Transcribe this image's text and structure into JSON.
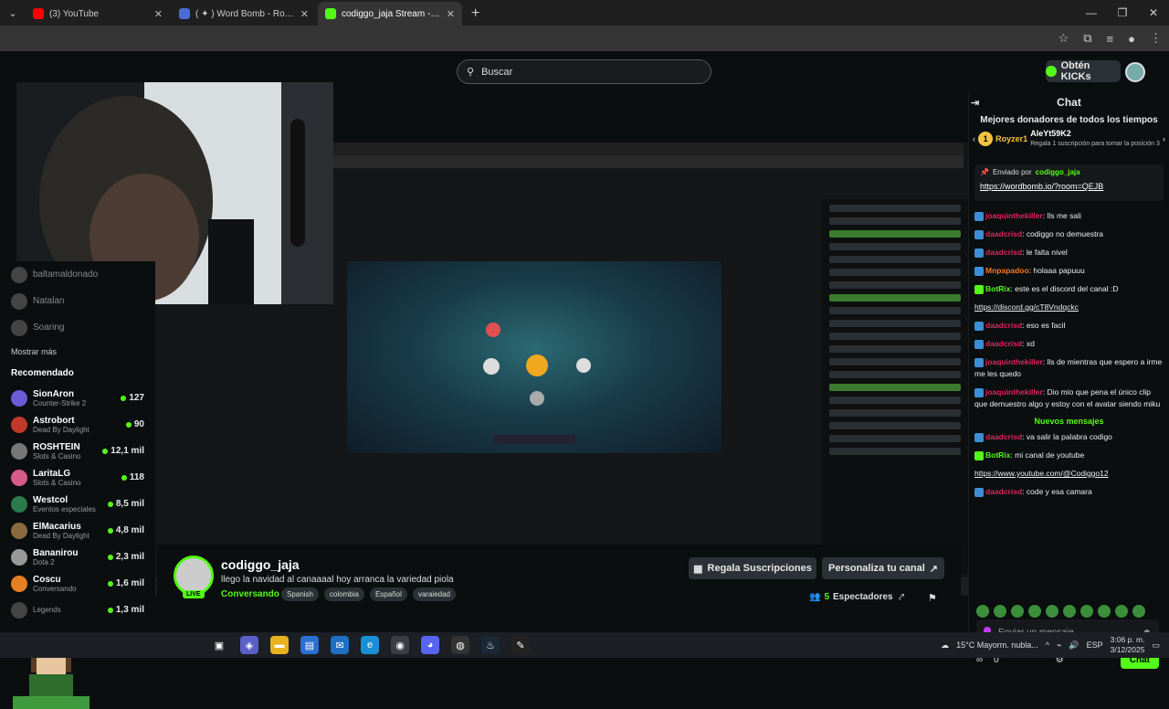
{
  "browser": {
    "tabs": [
      {
        "label": "(3) YouTube",
        "icon": "youtube-icon",
        "color": "#ff0000"
      },
      {
        "label": "( ✦ ) Word Bomb - Roblox",
        "icon": "roblox-icon",
        "color": "#4a6cd4"
      },
      {
        "label": "codiggo_jaja Stream - Watch L",
        "icon": "kick-icon",
        "color": "#53fc18"
      }
    ],
    "new_tab": "+"
  },
  "site": {
    "search_placeholder": "Buscar",
    "kicks_button": "Obtén KICKs"
  },
  "sidebar": {
    "offline": [
      {
        "name": "baltamaldonado"
      },
      {
        "name": "Natalan"
      },
      {
        "name": "Soaring"
      }
    ],
    "show_more": "Mostrar más",
    "recommended_title": "Recomendado",
    "recommended": [
      {
        "name": "SionAron",
        "game": "Counter-Strike 2",
        "viewers": "127",
        "color": "#6b5bd6"
      },
      {
        "name": "Astrobort",
        "game": "Dead By Daylight",
        "viewers": "90",
        "color": "#c0392b"
      },
      {
        "name": "ROSHTEIN",
        "game": "Slots & Casino",
        "viewers": "12,1 mil",
        "color": "#777"
      },
      {
        "name": "LaritaLG",
        "game": "Slots & Casino",
        "viewers": "118",
        "color": "#d65b8a"
      },
      {
        "name": "Westcol",
        "game": "Eventos especiales",
        "viewers": "8,5 mil",
        "color": "#2c7a4b"
      },
      {
        "name": "ElMacarius",
        "game": "Dead By Daylight",
        "viewers": "4,8 mil",
        "color": "#8a6b3d"
      },
      {
        "name": "Bananirou",
        "game": "Dota 2",
        "viewers": "2,3 mil",
        "color": "#999"
      },
      {
        "name": "Coscu",
        "game": "Conversando",
        "viewers": "1,6 mil",
        "color": "#e67e22"
      },
      {
        "name": "",
        "game": "Legends",
        "viewers": "1,3 mil",
        "color": "#444"
      }
    ]
  },
  "channel": {
    "name": "codiggo_jaja",
    "title": "llego la navidad al canaaaal hoy arranca la variedad piola",
    "category": "Conversando",
    "tags": [
      "Spanish",
      "colombia",
      "Español",
      "varaiedad"
    ],
    "live_badge": "LIVE",
    "gift_button": "Regala Suscripciones",
    "customize_button": "Personaliza tu canal",
    "viewers_count": "5",
    "viewers_label": "Espectadores"
  },
  "chat": {
    "title": "Chat",
    "donors_title": "Mejores donadores de todos los tiempos",
    "donor1": "Royzer1",
    "donor2": "AleYt59K2",
    "donor2_note": "Regala 1 suscripción para tomar la posición 3",
    "pinned_by": "Enviado por",
    "pinned_user": "codiggo_jaja",
    "pinned_link": "https://wordbomb.io/?room=QEJB",
    "messages": [
      {
        "user": "joaquinthekiller",
        "cls": "red",
        "text": ": lls me sali"
      },
      {
        "user": "daadcrisd",
        "cls": "red",
        "text": ": codiggo no demuestra"
      },
      {
        "user": "daadcrisd",
        "cls": "red",
        "text": ": le falta nivel"
      },
      {
        "user": "Mnpapadoo",
        "cls": "ora",
        "text": ": holaaa papuuu"
      },
      {
        "user": "BotRix",
        "cls": "grn",
        "text": ": este es el discord del canal :D"
      },
      {
        "user": "",
        "cls": "",
        "text": "https://discord.gg/cT8Vndqckc"
      },
      {
        "user": "daadcrisd",
        "cls": "red",
        "text": ": eso es facil"
      },
      {
        "user": "daadcrisd",
        "cls": "red",
        "text": ": xd"
      },
      {
        "user": "joaquinthekiller",
        "cls": "red",
        "text": ": lls de mientras que espero a irme me les quedo"
      },
      {
        "user": "joaquinthekiller",
        "cls": "red",
        "text": ": Dio mio que pena el único clip que demuestro algo y estoy con el avatar siendo miku"
      }
    ],
    "new_messages_label": "Nuevos mensajes",
    "new_messages": [
      {
        "user": "daadcrisd",
        "cls": "red",
        "text": ": va salir la palabra codigo"
      },
      {
        "user": "BotRix",
        "cls": "grn",
        "text": ": mi canal de youtube"
      },
      {
        "user": "",
        "cls": "",
        "text": "https://www.youtube.com/@Codiggo12"
      },
      {
        "user": "daadcrisd",
        "cls": "red",
        "text": ": code y esa camara"
      }
    ],
    "input_placeholder": "Enviar un mensaje",
    "kicks_balance": "0",
    "send_button": "Chat"
  },
  "taskbar": {
    "weather": "15°C  Mayorm. nubla...",
    "lang": "ESP",
    "time": "3:06 p. m.",
    "date": "3/12/2025"
  },
  "colors": {
    "accent": "#53fc18",
    "background": "#0b0e0f"
  }
}
